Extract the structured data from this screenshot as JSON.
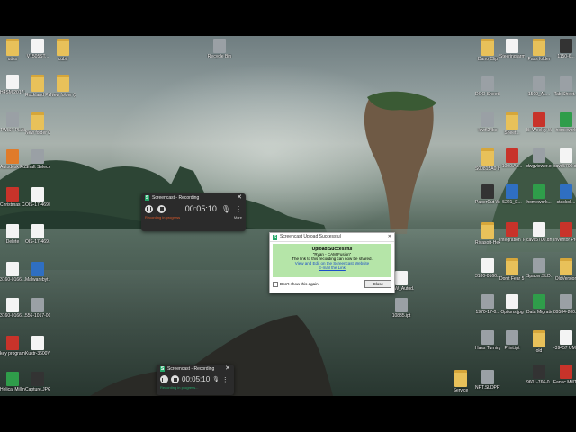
{
  "desktop": {
    "icons": [
      {
        "label": "uttsx",
        "kind": "folder"
      },
      {
        "label": "V1505ST...",
        "kind": "file"
      },
      {
        "label": "cubit",
        "kind": "folder"
      },
      {
        "label": "H4SM 2017.txt",
        "kind": "file"
      },
      {
        "label": "Rockland Parts",
        "kind": "folder"
      },
      {
        "label": "New folder (3)",
        "kind": "folder"
      },
      {
        "label": "TWIST PLASTIC C...",
        "kind": "gray"
      },
      {
        "label": "New folder (2)",
        "kind": "folder"
      },
      {
        "label": "Autodesk Fusion 360",
        "kind": "orange"
      },
      {
        "label": "Shaft Selector Xpert",
        "kind": "gray"
      },
      {
        "label": "Christmas Card.jpg",
        "kind": "red"
      },
      {
        "label": "OIS-17-469 NPT MACH...",
        "kind": "file"
      },
      {
        "label": "Delete",
        "kind": "file"
      },
      {
        "label": "OIS-17-469...",
        "kind": "file"
      },
      {
        "label": "3160-0166...",
        "kind": "file"
      },
      {
        "label": "Malwarebyt... Anti-Malware",
        "kind": "blue"
      },
      {
        "label": "3160-0166...",
        "kind": "file"
      },
      {
        "label": "556-1017-000 Item 1_03.ipt",
        "kind": "gray"
      },
      {
        "label": "key program.pdf",
        "kind": "red"
      },
      {
        "label": "Kustr-3600V WIDE.STEP",
        "kind": "file"
      },
      {
        "label": "Helical Milling A...",
        "kind": "green"
      },
      {
        "label": "Capture.JPG",
        "kind": "dark"
      },
      {
        "label": "Recycle Bin",
        "kind": "gray"
      },
      {
        "label": "1CW_Autod...",
        "kind": "file"
      },
      {
        "label": "10835.ipt",
        "kind": "gray"
      },
      {
        "label": "Service",
        "kind": "folder"
      },
      {
        "label": "NPT.SLDPRT",
        "kind": "gray"
      },
      {
        "label": "Dano Clip",
        "kind": "folder"
      },
      {
        "label": "Steering arm spl.STEP",
        "kind": "file"
      },
      {
        "label": "Pass folder",
        "kind": "folder"
      },
      {
        "label": "1150-6...",
        "kind": "dark"
      },
      {
        "label": "DOO Sheet NPT...",
        "kind": "gray"
      },
      {
        "label": "1509_AL...",
        "kind": "gray"
      },
      {
        "label": "Tab Sheet...",
        "kind": "gray"
      },
      {
        "label": "kfwfl24be",
        "kind": "gray"
      },
      {
        "label": "Sheet...",
        "kind": "folder"
      },
      {
        "label": "Bi-Weekly Whitm rec...",
        "kind": "red"
      },
      {
        "label": "homework",
        "kind": "green"
      },
      {
        "label": "S00815A0 Inv Transfer...",
        "kind": "folder"
      },
      {
        "label": "1000.Ac...",
        "kind": "red"
      },
      {
        "label": "dwgviewer.exe",
        "kind": "gray"
      },
      {
        "label": "cavs5700.dng",
        "kind": "file"
      },
      {
        "label": "PaperCut Web Print...",
        "kind": "dark"
      },
      {
        "label": "5221_E...",
        "kind": "blue"
      },
      {
        "label": "homework...",
        "kind": "green"
      },
      {
        "label": "stackoll...",
        "kind": "blue"
      },
      {
        "label": "Rivasoft-Hex Wall...",
        "kind": "folder"
      },
      {
        "label": "Integration Tech CP4...",
        "kind": "red"
      },
      {
        "label": "cavs5700.dng",
        "kind": "file"
      },
      {
        "label": "Inventor Professional...",
        "kind": "red"
      },
      {
        "label": "3180-0166...",
        "kind": "file"
      },
      {
        "label": "Don't Fear 5 Arrconc",
        "kind": "folder"
      },
      {
        "label": "Spacer.SLD...",
        "kind": "gray"
      },
      {
        "label": "OldVersion",
        "kind": "folder"
      },
      {
        "label": "1970-17-0...",
        "kind": "gray"
      },
      {
        "label": "Options.jpg",
        "kind": "file"
      },
      {
        "label": "Data Migration",
        "kind": "green"
      },
      {
        "label": "89584-200...",
        "kind": "gray"
      },
      {
        "label": "Hass Turning.cps",
        "kind": "gray"
      },
      {
        "label": "Print.ipt",
        "kind": "gray"
      },
      {
        "label": "old",
        "kind": "folder"
      },
      {
        "label": "-39457 UMIF18-SA...",
        "kind": "file"
      },
      {
        "label": "9601-766-0...",
        "kind": "dark"
      },
      {
        "label": "Fanuc MillTur...",
        "kind": "red"
      }
    ]
  },
  "recorder_top": {
    "title": "Screencast - Recording",
    "time": "00:05:10",
    "status": "Recording in progress",
    "more": "More"
  },
  "recorder_bottom": {
    "title": "Screencast - Recording",
    "time": "00:05:10",
    "status": "Recording in progress..."
  },
  "upload_dialog": {
    "title": "Screencast Upload Successful",
    "heading": "Upload Successful",
    "item_name": "\"Ryan - CAM Fusion\"",
    "message": "The link to this recording can now be shared.",
    "link_view": "View and Edit on the Screencast Website",
    "link_email": "E-mail the Link",
    "checkbox_label": "Don't show this again",
    "close_label": "Close"
  }
}
